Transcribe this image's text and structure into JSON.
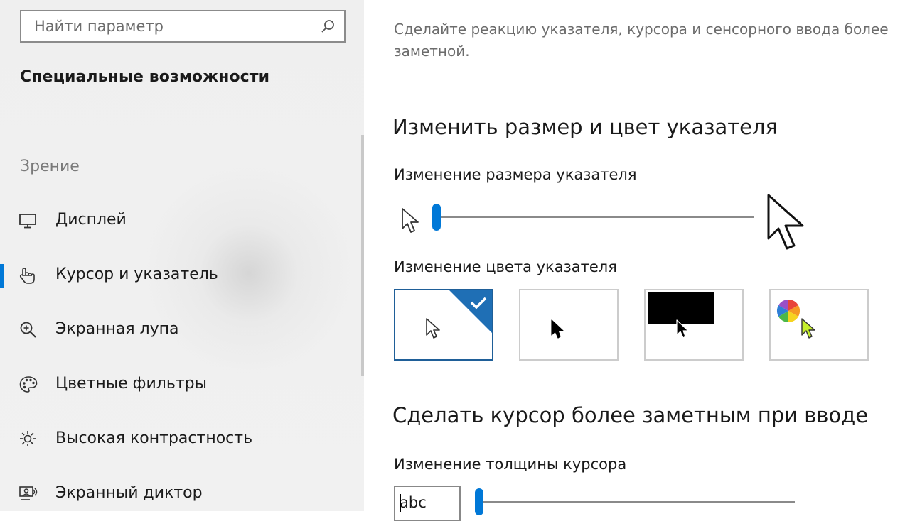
{
  "search": {
    "placeholder": "Найти параметр"
  },
  "sidebar": {
    "title": "Специальные возможности",
    "group_label": "Зрение",
    "items": [
      {
        "label": "Дисплей",
        "icon": "monitor-icon"
      },
      {
        "label": "Курсор и указатель",
        "icon": "hand-pointer-icon",
        "selected": true
      },
      {
        "label": "Экранная лупа",
        "icon": "magnifier-icon"
      },
      {
        "label": "Цветные фильтры",
        "icon": "palette-icon"
      },
      {
        "label": "Высокая контрастность",
        "icon": "brightness-icon"
      },
      {
        "label": "Экранный диктор",
        "icon": "narrator-icon"
      }
    ]
  },
  "main": {
    "intro": "Сделайте реакцию указателя, курсора и сенсорного ввода более заметной.",
    "pointer_section": {
      "heading": "Изменить размер и цвет указателя",
      "size_label": "Изменение размера указателя",
      "size_value": 1,
      "color_label": "Изменение цвета указателя",
      "color_options": [
        {
          "id": "white",
          "selected": true
        },
        {
          "id": "black",
          "selected": false
        },
        {
          "id": "inverted",
          "selected": false
        },
        {
          "id": "custom",
          "selected": false
        }
      ]
    },
    "cursor_section": {
      "heading": "Сделать курсор более заметным при вводе",
      "thickness_label": "Изменение толщины курсора",
      "preview_text": "abc",
      "thickness_value": 1
    }
  },
  "colors": {
    "accent": "#0078d7",
    "selected_border": "#1f5f98",
    "sidebar_bg": "#f0f0f0"
  }
}
